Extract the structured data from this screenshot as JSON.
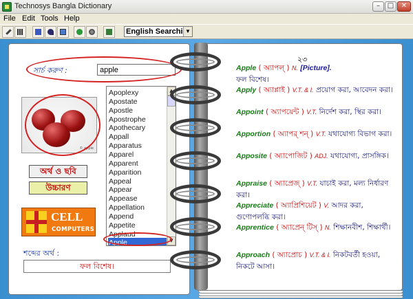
{
  "window": {
    "title": "Technosys Bangla Dictionary",
    "min": "–",
    "max": "□",
    "close": "✕"
  },
  "menu": [
    "File",
    "Edit",
    "Tools",
    "Help"
  ],
  "toolbar": {
    "search_mode": "English Searching",
    "dropdown_arrow": "▼"
  },
  "search": {
    "label": "সার্চ করুণ :",
    "value": "apple"
  },
  "wordlist": {
    "items": [
      "Apoplexy",
      "Apostate",
      "Apostle",
      "Apostrophe",
      "Apothecary",
      "Appall",
      "Apparatus",
      "Apparel",
      "Apparent",
      "Apparition",
      "Appeal",
      "Appear",
      "Appease",
      "Appellation",
      "Append",
      "Appetite",
      "Applaud",
      "Apple"
    ],
    "selected_index": 17,
    "scroll_up": "▲",
    "scroll_down": "▼"
  },
  "picture": {
    "caption": "© apple"
  },
  "buttons": {
    "meaning_picture": "অর্থ ও ছবি",
    "pronounce": "উচ্চারণ"
  },
  "logo": {
    "line1": "CELL",
    "line2": "COMPUTERS"
  },
  "meaning": {
    "label": "শব্দের অর্থ :",
    "value": "ফল বিশেষ।"
  },
  "page": {
    "number": "২৩"
  },
  "entries": [
    {
      "word": "Apple",
      "pron": "( অ্যাপল্ )",
      "pos": "N.",
      "meaning": "ফল বিশেষ।",
      "extra": "[Picture]."
    },
    {
      "word": "Apply",
      "pron": "( অ্যাপ্লাই )",
      "pos": "V.T. & I.",
      "meaning": "প্রয়োগ করা, আবেদন করা।"
    },
    {
      "word": "Appoint",
      "pron": "( অ্যাপয়েন্ট )",
      "pos": "V.T.",
      "meaning": "নির্দেশ করা, স্থির করা।"
    },
    {
      "word": "Apportion",
      "pron": "( অ্যাপর্ শন্ )",
      "pos": "V.T.",
      "meaning": "যথাযোগ্য বিভাগ করা।"
    },
    {
      "word": "Apposite",
      "pron": "( অ্যাপোজিট )",
      "pos": "ADJ.",
      "meaning": "যথাযোগ্য, প্রাসঙ্গিক।"
    },
    {
      "word": "Appraise",
      "pron": "( অ্যাপ্রেজ্ )",
      "pos": "V.T.",
      "meaning": "যাচাই করা, মল্য নির্ধারণ করা।"
    },
    {
      "word": "Appreciate",
      "pron": "( অ্যাপ্রিশিয়েট )",
      "pos": "V.",
      "meaning": "আদর করা, গুণোপলব্ধি করা।"
    },
    {
      "word": "Apprentice",
      "pron": "( অ্যাপ্রেন্ টিস্ )",
      "pos": "N.",
      "meaning": "শিক্ষানবীশ, শিক্ষার্থী।"
    },
    {
      "word": "Approach",
      "pron": "( অ্যাপ্রোচ )",
      "pos": "V.T. & I.",
      "meaning": "নিকটবর্তী হওয়া, নিকটে আসা।"
    }
  ]
}
